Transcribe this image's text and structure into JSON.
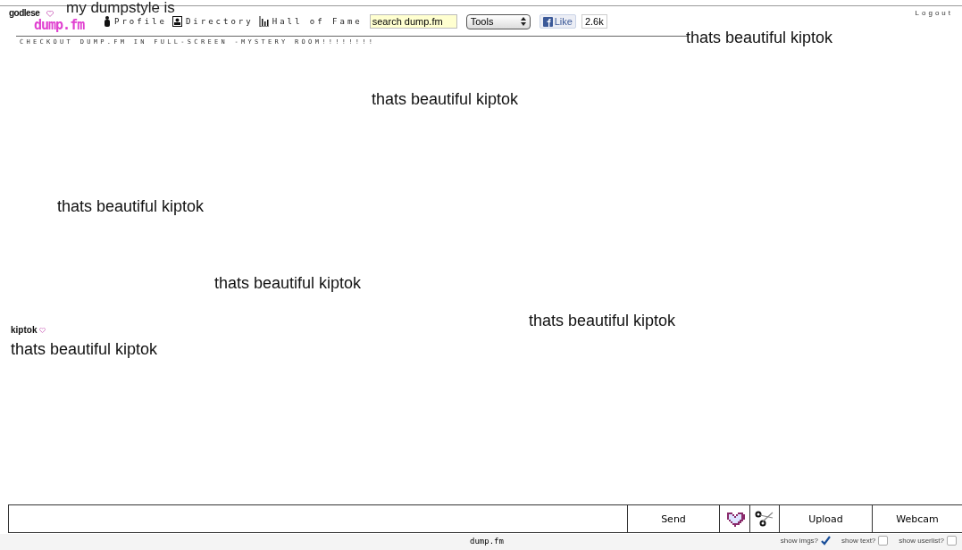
{
  "header": {
    "username": "godlese",
    "logo": "dump.fm",
    "dumpstyle": "my dumpstyle is",
    "nav": [
      {
        "label": "Profile",
        "kind": "person"
      },
      {
        "label": "Directory",
        "kind": "card"
      },
      {
        "label": "Hall of Fame",
        "kind": "chart"
      }
    ],
    "search": {
      "value": "search dump.fm"
    },
    "tools": "Tools",
    "like": {
      "label": "Like",
      "count": "2.6k"
    },
    "logout": "Logout",
    "announcement": "CHECKOUT DUMP.FM IN FULL-SCREEN -MYSTERY ROOM!!!!!!!!"
  },
  "messages": [
    {
      "text": "thats beautiful kiptok"
    },
    {
      "text": "thats beautiful kiptok"
    },
    {
      "text": "thats beautiful kiptok"
    },
    {
      "text": "thats beautiful kiptok"
    },
    {
      "text": "thats beautiful kiptok"
    },
    {
      "user": "kiptok",
      "text": "thats beautiful kiptok"
    }
  ],
  "composer": {
    "send": "Send",
    "upload": "Upload",
    "webcam": "Webcam"
  },
  "footer": {
    "site": "dump.fm",
    "toggles": [
      {
        "label": "show imgs?",
        "checked": true
      },
      {
        "label": "show text?",
        "checked": false
      },
      {
        "label": "show userlist?",
        "checked": false
      }
    ]
  }
}
